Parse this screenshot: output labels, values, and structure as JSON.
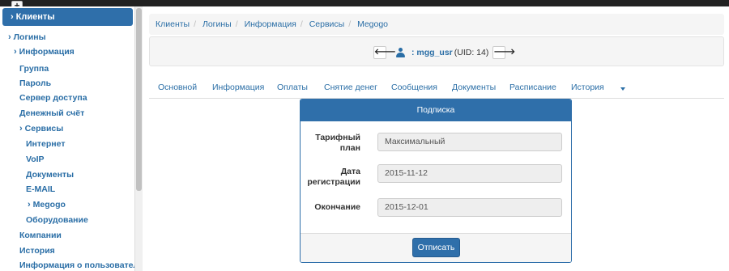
{
  "topbar": {
    "plus_glyph": "+"
  },
  "sidebar": {
    "active_item": "Клиенты",
    "items": [
      {
        "label": "Логины",
        "chevron": true
      },
      {
        "label": "Информация",
        "chevron": true
      },
      {
        "label": "Группа"
      },
      {
        "label": "Пароль"
      },
      {
        "label": "Сервер доступа"
      },
      {
        "label": "Денежный счёт"
      },
      {
        "label": "Сервисы",
        "chevron": true
      },
      {
        "label": "Интернет"
      },
      {
        "label": "VoIP"
      },
      {
        "label": "Документы"
      },
      {
        "label": "E-MAIL"
      },
      {
        "label": "Megogo",
        "chevron": true
      },
      {
        "label": "Оборудование"
      },
      {
        "label": "Компании"
      },
      {
        "label": "История"
      },
      {
        "label": "Информация о пользователе"
      }
    ]
  },
  "breadcrumb": [
    "Клиенты",
    "Логины",
    "Информация",
    "Сервисы",
    "Megogo"
  ],
  "userbar": {
    "login": ": mgg_usr",
    "uid": "(UID: 14)",
    "prev_glyph": "🡐",
    "next_glyph": "🡒"
  },
  "tabs": [
    "Основной",
    "Информация",
    "Оплаты",
    "Снятие денег",
    "Сообщения",
    "Документы",
    "Расписание",
    "История"
  ],
  "panel": {
    "title": "Подписка",
    "fields": [
      {
        "label_line1": "Тарифный",
        "label_line2": "план",
        "value": "Максимальный"
      },
      {
        "label_line1": "Дата",
        "label_line2": "регистрации",
        "value": "2015-11-12"
      },
      {
        "label_line1": "Окончание",
        "label_line2": "",
        "value": "2015-12-01"
      }
    ],
    "button": "Отписать"
  },
  "colors": {
    "primary": "#2f6faa",
    "link": "#2a6ea6",
    "well": "#f5f5f5"
  }
}
